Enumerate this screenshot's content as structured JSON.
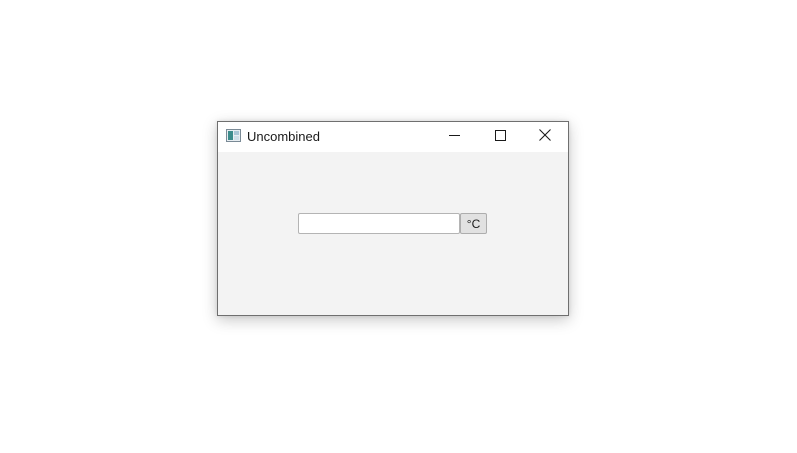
{
  "window": {
    "title": "Uncombined",
    "app_icon": "app-window-icon",
    "controls": {
      "minimize_icon": "minimize-icon",
      "maximize_icon": "maximize-icon",
      "close_icon": "close-icon"
    }
  },
  "form": {
    "temperature_input": {
      "value": "",
      "placeholder": ""
    },
    "unit_button_label": "°C"
  },
  "colors": {
    "client_background": "#f3f3f3",
    "titlebar_background": "#ffffff",
    "window_border": "#6f6f6f",
    "button_background": "#e1e1e1"
  }
}
